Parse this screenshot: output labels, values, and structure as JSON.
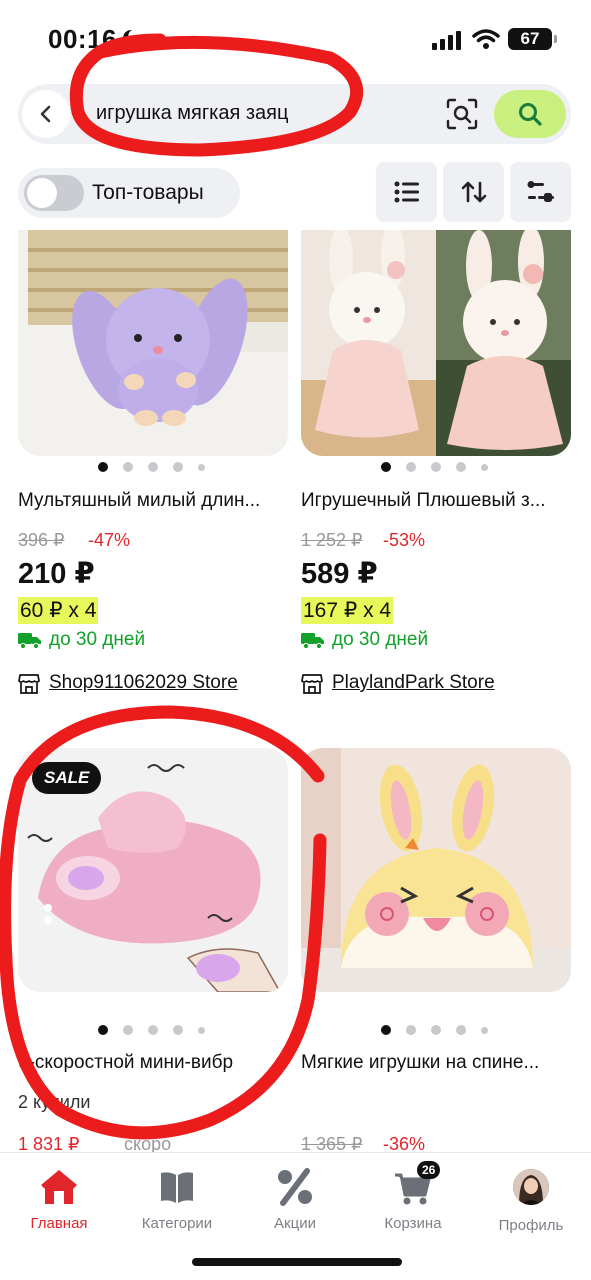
{
  "status_bar": {
    "time": "00:16",
    "battery": "67"
  },
  "search": {
    "query": "игрушка мягкая заяц"
  },
  "filters": {
    "top_toggle_label": "Топ-товары"
  },
  "products": [
    {
      "title": "Мультяшный милый длин...",
      "old_price": "396 ₽",
      "discount": "-47%",
      "price": "210 ₽",
      "installment": "60 ₽ x 4",
      "delivery": "до 30 дней",
      "store": "Shop911062029 Store"
    },
    {
      "title": "Игрушечный Плюшевый з...",
      "old_price": "1 252 ₽",
      "discount": "-53%",
      "price": "589 ₽",
      "installment": "167 ₽ x 4",
      "delivery": "до 30 дней",
      "store": "PlaylandPark Store"
    },
    {
      "badge": "SALE",
      "title": "9-скоростной мини-вибр",
      "sold": "2 купили",
      "price_partial": "1 831 ₽",
      "note_partial": "скоро"
    },
    {
      "title": "Мягкие игрушки на спине...",
      "old_price": "1 365 ₽",
      "discount": "-36%"
    }
  ],
  "tabbar": {
    "items": [
      {
        "label": "Главная",
        "icon": "home-icon"
      },
      {
        "label": "Категории",
        "icon": "book-icon"
      },
      {
        "label": "Акции",
        "icon": "percent-icon"
      },
      {
        "label": "Корзина",
        "icon": "cart-icon",
        "badge": "26"
      },
      {
        "label": "Профиль",
        "icon": "avatar"
      }
    ]
  },
  "colors": {
    "accent_red": "#e1262b",
    "search_button": "#c9f07e",
    "installment_highlight": "#e6f85a",
    "delivery_green": "#12a12a",
    "annotation_red": "#ec1c1c"
  }
}
